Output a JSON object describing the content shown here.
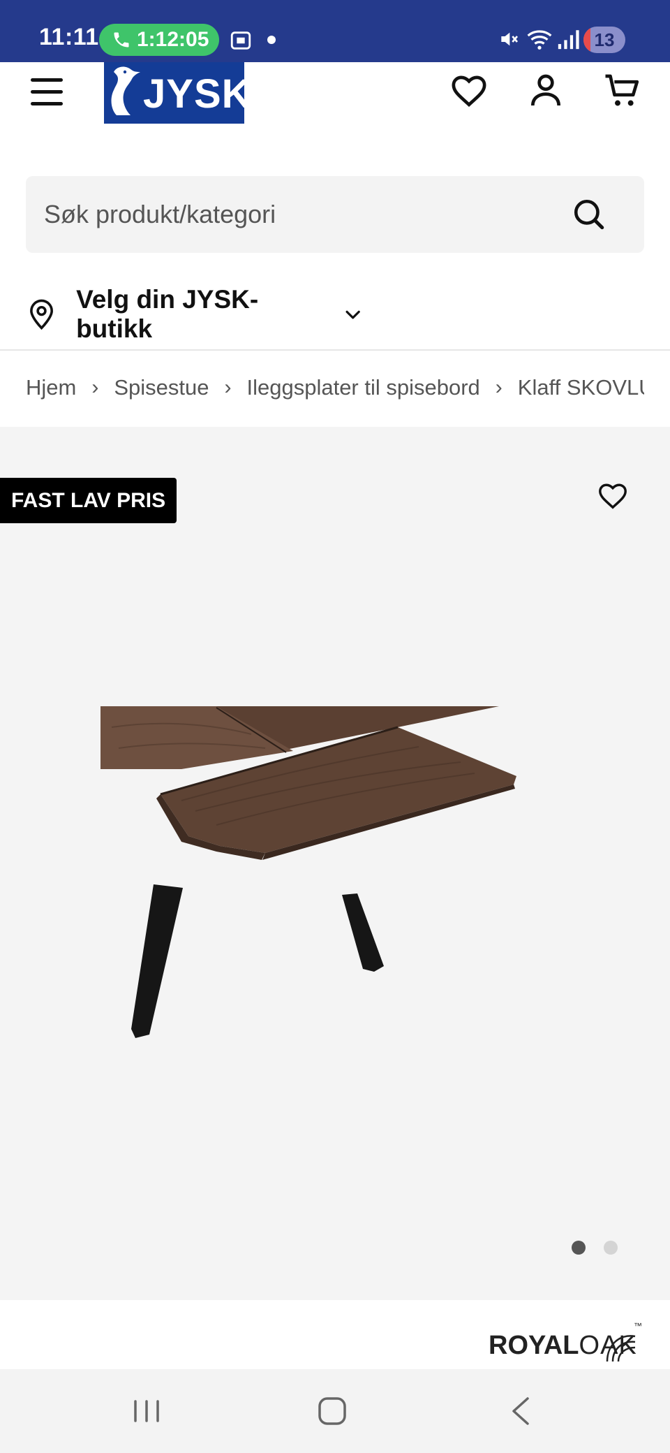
{
  "status_bar": {
    "time": "11:11",
    "call_timer": "1:12:05",
    "notification_count": "13"
  },
  "header": {
    "logo_text": "JYSK"
  },
  "search": {
    "placeholder": "Søk produkt/kategori"
  },
  "store_selector": {
    "label": "Velg din JYSK-butikk"
  },
  "breadcrumb": {
    "items": [
      "Hjem",
      "Spisestue",
      "Ileggsplater til spisebord",
      "Klaff SKOVLU"
    ]
  },
  "product": {
    "badge": "FAST LAV PRIS",
    "gallery_count": 2,
    "gallery_active_index": 1
  },
  "brand": {
    "part1": "ROYAL",
    "part2": "OAK",
    "tm": "™"
  },
  "colors": {
    "status_bar_bg": "#253a8c",
    "brand_blue": "#143c96",
    "call_green": "#3fc46a",
    "gallery_bg": "#f4f4f4"
  }
}
